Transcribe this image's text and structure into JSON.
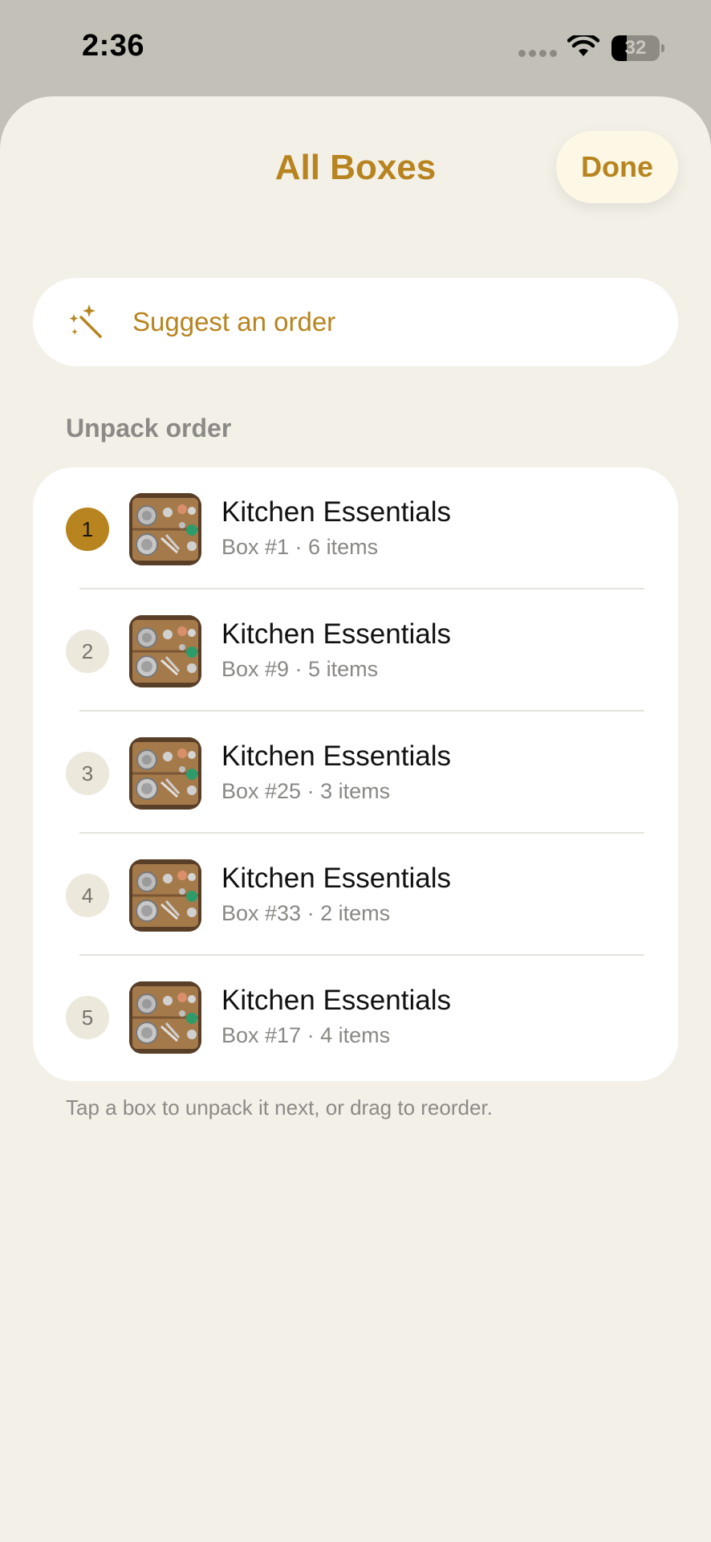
{
  "status_bar": {
    "time": "2:36",
    "battery": "32",
    "battery_level": 0.32
  },
  "header": {
    "title": "All Boxes",
    "done_label": "Done"
  },
  "suggest": {
    "label": "Suggest an order",
    "icon": "magic-wand-icon"
  },
  "section": {
    "header": "Unpack order"
  },
  "boxes": [
    {
      "rank": "1",
      "title": "Kitchen Essentials",
      "subtitle": "Box #1 · 6 items",
      "active": true
    },
    {
      "rank": "2",
      "title": "Kitchen Essentials",
      "subtitle": "Box #9 · 5 items",
      "active": false
    },
    {
      "rank": "3",
      "title": "Kitchen Essentials",
      "subtitle": "Box #25 · 3 items",
      "active": false
    },
    {
      "rank": "4",
      "title": "Kitchen Essentials",
      "subtitle": "Box #33 · 2 items",
      "active": false
    },
    {
      "rank": "5",
      "title": "Kitchen Essentials",
      "subtitle": "Box #17 · 4 items",
      "active": false
    }
  ],
  "footer": {
    "hint": "Tap a box to unpack it next, or drag to reorder."
  },
  "colors": {
    "accent": "#b7841f",
    "sheet_bg": "#f3f0e8",
    "backdrop": "#c3c0b7"
  }
}
